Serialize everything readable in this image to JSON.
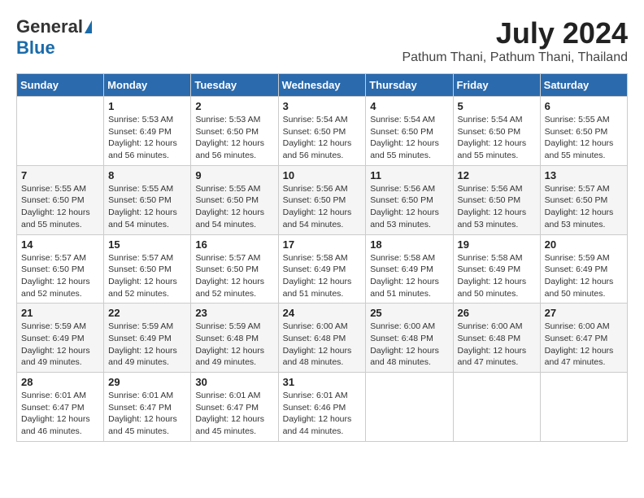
{
  "header": {
    "logo_general": "General",
    "logo_blue": "Blue",
    "title": "July 2024",
    "location": "Pathum Thani, Pathum Thani, Thailand"
  },
  "days": [
    "Sunday",
    "Monday",
    "Tuesday",
    "Wednesday",
    "Thursday",
    "Friday",
    "Saturday"
  ],
  "weeks": [
    [
      {
        "date": "",
        "info": ""
      },
      {
        "date": "1",
        "info": "Sunrise: 5:53 AM\nSunset: 6:49 PM\nDaylight: 12 hours\nand 56 minutes."
      },
      {
        "date": "2",
        "info": "Sunrise: 5:53 AM\nSunset: 6:50 PM\nDaylight: 12 hours\nand 56 minutes."
      },
      {
        "date": "3",
        "info": "Sunrise: 5:54 AM\nSunset: 6:50 PM\nDaylight: 12 hours\nand 56 minutes."
      },
      {
        "date": "4",
        "info": "Sunrise: 5:54 AM\nSunset: 6:50 PM\nDaylight: 12 hours\nand 55 minutes."
      },
      {
        "date": "5",
        "info": "Sunrise: 5:54 AM\nSunset: 6:50 PM\nDaylight: 12 hours\nand 55 minutes."
      },
      {
        "date": "6",
        "info": "Sunrise: 5:55 AM\nSunset: 6:50 PM\nDaylight: 12 hours\nand 55 minutes."
      }
    ],
    [
      {
        "date": "7",
        "info": "Sunrise: 5:55 AM\nSunset: 6:50 PM\nDaylight: 12 hours\nand 55 minutes."
      },
      {
        "date": "8",
        "info": "Sunrise: 5:55 AM\nSunset: 6:50 PM\nDaylight: 12 hours\nand 54 minutes."
      },
      {
        "date": "9",
        "info": "Sunrise: 5:55 AM\nSunset: 6:50 PM\nDaylight: 12 hours\nand 54 minutes."
      },
      {
        "date": "10",
        "info": "Sunrise: 5:56 AM\nSunset: 6:50 PM\nDaylight: 12 hours\nand 54 minutes."
      },
      {
        "date": "11",
        "info": "Sunrise: 5:56 AM\nSunset: 6:50 PM\nDaylight: 12 hours\nand 53 minutes."
      },
      {
        "date": "12",
        "info": "Sunrise: 5:56 AM\nSunset: 6:50 PM\nDaylight: 12 hours\nand 53 minutes."
      },
      {
        "date": "13",
        "info": "Sunrise: 5:57 AM\nSunset: 6:50 PM\nDaylight: 12 hours\nand 53 minutes."
      }
    ],
    [
      {
        "date": "14",
        "info": "Sunrise: 5:57 AM\nSunset: 6:50 PM\nDaylight: 12 hours\nand 52 minutes."
      },
      {
        "date": "15",
        "info": "Sunrise: 5:57 AM\nSunset: 6:50 PM\nDaylight: 12 hours\nand 52 minutes."
      },
      {
        "date": "16",
        "info": "Sunrise: 5:57 AM\nSunset: 6:50 PM\nDaylight: 12 hours\nand 52 minutes."
      },
      {
        "date": "17",
        "info": "Sunrise: 5:58 AM\nSunset: 6:49 PM\nDaylight: 12 hours\nand 51 minutes."
      },
      {
        "date": "18",
        "info": "Sunrise: 5:58 AM\nSunset: 6:49 PM\nDaylight: 12 hours\nand 51 minutes."
      },
      {
        "date": "19",
        "info": "Sunrise: 5:58 AM\nSunset: 6:49 PM\nDaylight: 12 hours\nand 50 minutes."
      },
      {
        "date": "20",
        "info": "Sunrise: 5:59 AM\nSunset: 6:49 PM\nDaylight: 12 hours\nand 50 minutes."
      }
    ],
    [
      {
        "date": "21",
        "info": "Sunrise: 5:59 AM\nSunset: 6:49 PM\nDaylight: 12 hours\nand 49 minutes."
      },
      {
        "date": "22",
        "info": "Sunrise: 5:59 AM\nSunset: 6:49 PM\nDaylight: 12 hours\nand 49 minutes."
      },
      {
        "date": "23",
        "info": "Sunrise: 5:59 AM\nSunset: 6:48 PM\nDaylight: 12 hours\nand 49 minutes."
      },
      {
        "date": "24",
        "info": "Sunrise: 6:00 AM\nSunset: 6:48 PM\nDaylight: 12 hours\nand 48 minutes."
      },
      {
        "date": "25",
        "info": "Sunrise: 6:00 AM\nSunset: 6:48 PM\nDaylight: 12 hours\nand 48 minutes."
      },
      {
        "date": "26",
        "info": "Sunrise: 6:00 AM\nSunset: 6:48 PM\nDaylight: 12 hours\nand 47 minutes."
      },
      {
        "date": "27",
        "info": "Sunrise: 6:00 AM\nSunset: 6:47 PM\nDaylight: 12 hours\nand 47 minutes."
      }
    ],
    [
      {
        "date": "28",
        "info": "Sunrise: 6:01 AM\nSunset: 6:47 PM\nDaylight: 12 hours\nand 46 minutes."
      },
      {
        "date": "29",
        "info": "Sunrise: 6:01 AM\nSunset: 6:47 PM\nDaylight: 12 hours\nand 45 minutes."
      },
      {
        "date": "30",
        "info": "Sunrise: 6:01 AM\nSunset: 6:47 PM\nDaylight: 12 hours\nand 45 minutes."
      },
      {
        "date": "31",
        "info": "Sunrise: 6:01 AM\nSunset: 6:46 PM\nDaylight: 12 hours\nand 44 minutes."
      },
      {
        "date": "",
        "info": ""
      },
      {
        "date": "",
        "info": ""
      },
      {
        "date": "",
        "info": ""
      }
    ]
  ]
}
